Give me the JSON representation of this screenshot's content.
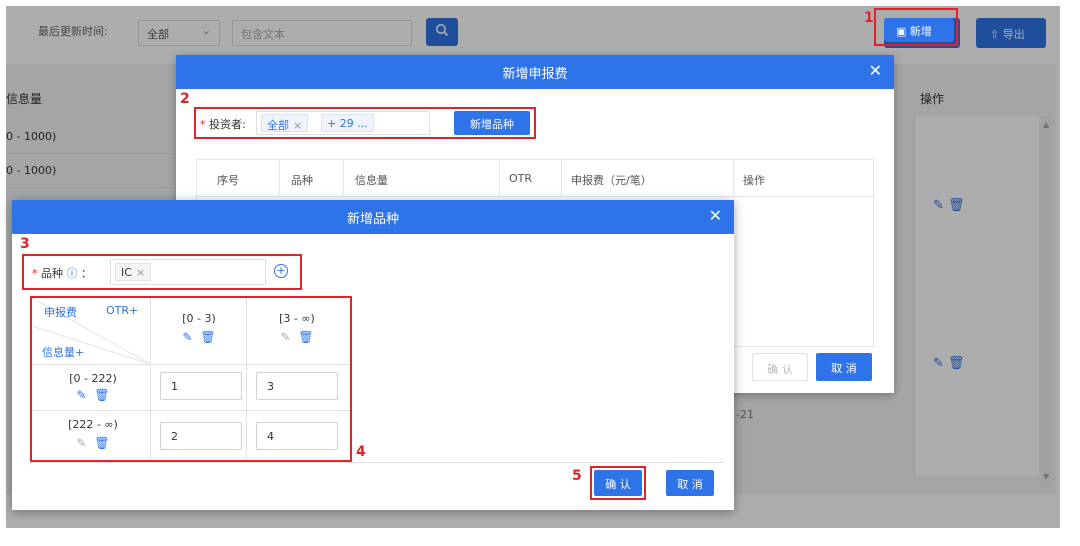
{
  "filter": {
    "last_update_label": "最后更新时间:",
    "last_update_value": "全部",
    "search_placeholder": "包含文本",
    "add_label": "新增",
    "export_label": "导出"
  },
  "background_table": {
    "col_info_header": "信息量",
    "col_ops_header": "操作",
    "rows": [
      "0 - 1000)",
      "0 - 1000)"
    ],
    "footer_fragment": "-21"
  },
  "dialog1": {
    "title": "新增申报费",
    "investor_label": "投资者:",
    "investor_tags": [
      "全部",
      "+ 29 ..."
    ],
    "add_variety_button": "新增品种",
    "headers": [
      "序号",
      "品种",
      "信息量",
      "OTR",
      "申报费（元/笔）",
      "操作"
    ],
    "confirm_label": "确 认",
    "cancel_label": "取 消"
  },
  "dialog2": {
    "title": "新增品种",
    "variety_label": "品种",
    "variety_suffix": "：",
    "variety_tag": "IC",
    "matrix": {
      "corner_fee": "申报费",
      "corner_otr": "OTR+",
      "corner_info": "信息量+",
      "columns": [
        "[0 - 3)",
        "[3 - ∞)"
      ],
      "rows": [
        {
          "label": "[0 - 222)",
          "values": [
            "1",
            "3"
          ]
        },
        {
          "label": "[222 - ∞)",
          "values": [
            "2",
            "4"
          ]
        }
      ]
    },
    "confirm_label": "确 认",
    "cancel_label": "取 消"
  },
  "annotations": [
    "1",
    "2",
    "3",
    "4",
    "5"
  ],
  "colors": {
    "primary": "#2f73e8",
    "annotation_red": "#e0222a"
  }
}
